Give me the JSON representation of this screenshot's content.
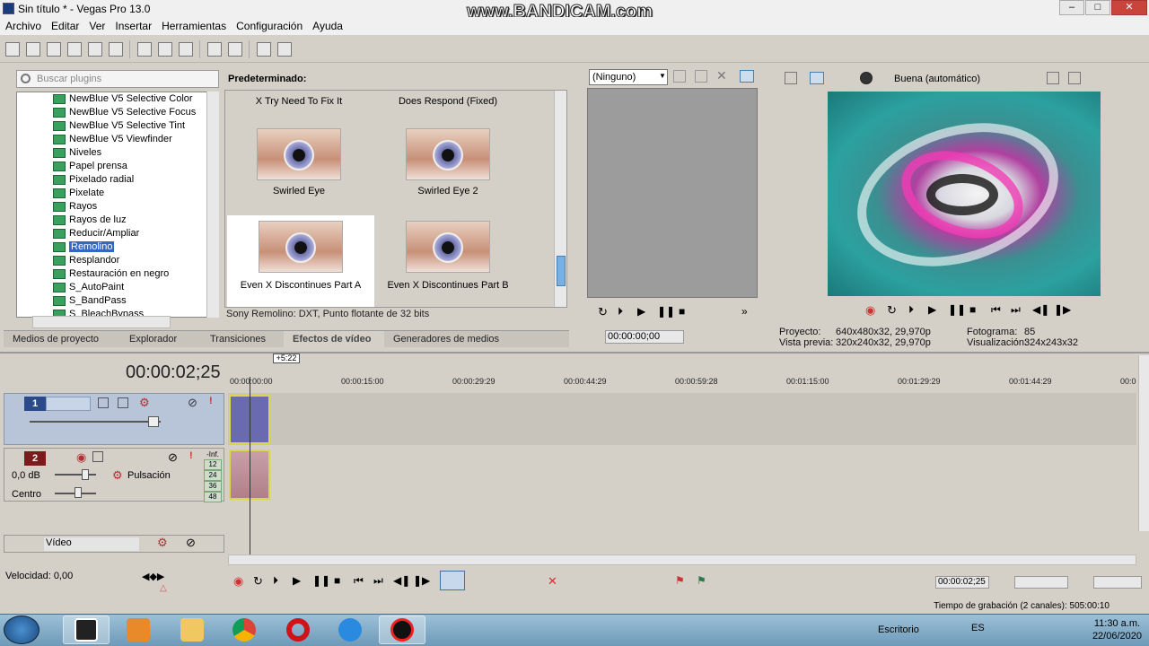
{
  "window": {
    "title": "Sin título * - Vegas Pro 13.0",
    "watermark": "www.BANDICAM.com",
    "min": "–",
    "max": "□",
    "close": "✕"
  },
  "menu": [
    "Archivo",
    "Editar",
    "Ver",
    "Insertar",
    "Herramientas",
    "Configuración",
    "Ayuda"
  ],
  "plugins": {
    "search_placeholder": "Buscar plugins",
    "items": [
      "NewBlue V5 Selective Color",
      "NewBlue V5 Selective Focus",
      "NewBlue V5 Selective Tint",
      "NewBlue V5 Viewfinder",
      "Niveles",
      "Papel prensa",
      "Pixelado radial",
      "Pixelate",
      "Rayos",
      "Rayos de luz",
      "Reducir/Ampliar",
      "Remolino",
      "Resplandor",
      "Restauración en negro",
      "S_AutoPaint",
      "S_BandPass",
      "S_BleachBypass"
    ],
    "selected_index": 11
  },
  "presets": {
    "header": "Predeterminado:",
    "top_labels": [
      "X Try Need To Fix It",
      "Does Respond (Fixed)"
    ],
    "items": [
      "Swirled Eye",
      "Swirled Eye 2",
      "Even X Discontinues Part A",
      "Even X Discontinues Part B"
    ],
    "selected": "Even X Discontinues Part A",
    "status": "Sony Remolino: DXT, Punto flotante de 32 bits"
  },
  "tabs": [
    "Medios de proyecto",
    "Explorador",
    "Transiciones",
    "Efectos de vídeo",
    "Generadores de medios"
  ],
  "active_tab": "Efectos de vídeo",
  "trimmer": {
    "dropdown": "(Ninguno)",
    "timecode": "00:00:00;00"
  },
  "preview": {
    "quality": "Buena (automático)",
    "proyecto_label": "Proyecto:",
    "proyecto": "640x480x32, 29,970p",
    "vista_label": "Vista previa:",
    "vista": "320x240x32, 29,970p",
    "fotograma_label": "Fotograma:",
    "fotograma": "85",
    "visual_label": "Visualización:",
    "visual": "324x243x32"
  },
  "timeline": {
    "timecode": "00:00:02;25",
    "region_badge": "+5:22",
    "ruler": [
      "00:00:00:00",
      "00:00:15:00",
      "00:00:29:29",
      "00:00:44:29",
      "00:00:59:28",
      "00:01:15:00",
      "00:01:29:29",
      "00:01:44:29",
      "00:0"
    ],
    "track1": {
      "num": "1"
    },
    "track2": {
      "num": "2",
      "volume": "0,0 dB",
      "pan": "Centro",
      "mode": "Pulsación",
      "meter": [
        "-Inf.",
        "12",
        "24",
        "36",
        "48"
      ]
    },
    "bus": {
      "label": "Vídeo"
    },
    "speed": "Velocidad: 0,00",
    "cursor_time": "00:00:02;25",
    "record_time": "Tiempo de grabación (2 canales): 505:00:10"
  },
  "taskbar": {
    "desktop": "Escritorio",
    "lang": "ES",
    "time": "11:30 a.m.",
    "date": "22/06/2020"
  },
  "colors": {
    "selection": "#3168c5",
    "track_video": "#b8c4d8",
    "clip_video": "#6a6ab0",
    "clip_border": "#d8d84a"
  }
}
